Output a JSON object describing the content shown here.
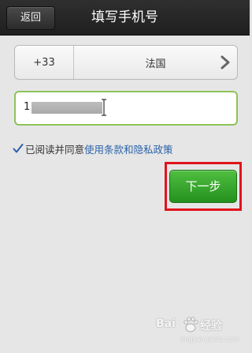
{
  "header": {
    "back_label": "返回",
    "title": "填写手机号"
  },
  "country": {
    "code": "+33",
    "name": "法国"
  },
  "phone": {
    "visible_prefix": "1"
  },
  "agreement": {
    "checked": true,
    "text": "已阅读并同意",
    "link": "使用条款和隐私政策"
  },
  "next_label": "下一步",
  "watermark": {
    "brand": "Bai",
    "brand_suffix": "经验",
    "url": "jingyan.baidu.com"
  },
  "colors": {
    "header_bg": "#262626",
    "accent_green": "#2fa52a",
    "field_border": "#8dc35a",
    "link_blue": "#2a62a8",
    "highlight_red": "#e0141b"
  },
  "icons": {
    "back": "back-button",
    "chevron": "chevron-right-icon",
    "check": "checkmark-icon",
    "cursor": "text-cursor-icon"
  }
}
